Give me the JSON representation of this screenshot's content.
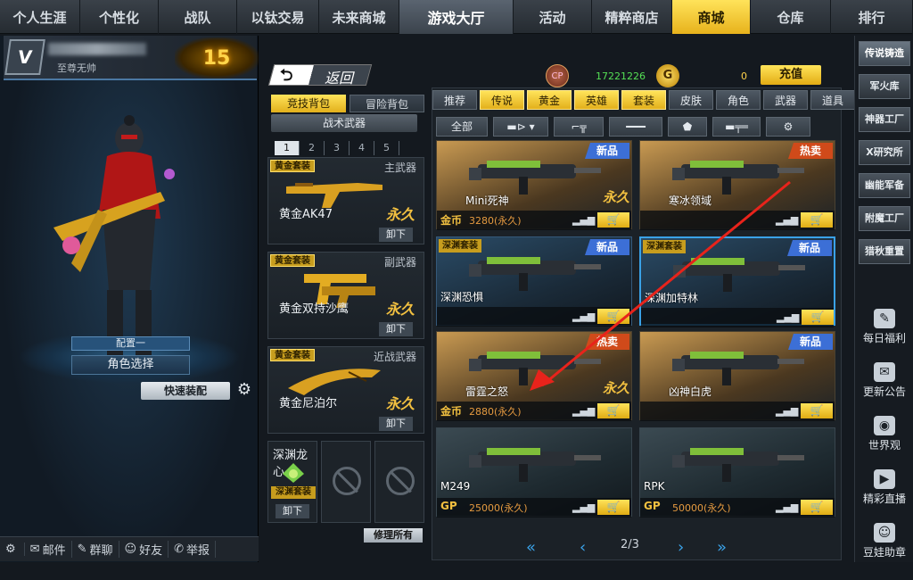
{
  "topnav": {
    "tabs": [
      {
        "label": "个人生涯",
        "w": 90
      },
      {
        "label": "个性化",
        "w": 88
      },
      {
        "label": "战队",
        "w": 88
      },
      {
        "label": "以钛交易",
        "w": 92
      },
      {
        "label": "未来商城",
        "w": 90
      },
      {
        "label": "游戏大厅",
        "w": 128
      },
      {
        "label": "活动",
        "w": 88
      },
      {
        "label": "精粹商店",
        "w": 90
      },
      {
        "label": "商城",
        "w": 88
      },
      {
        "label": "仓库",
        "w": 90
      },
      {
        "label": "排行",
        "w": 92
      }
    ]
  },
  "profile": {
    "badge": "V",
    "rank_level": "15",
    "rank_name": "至尊无帅"
  },
  "character": {
    "config_label": "配置一",
    "role_select": "角色选择",
    "quick_equip": "快速装配"
  },
  "bottombar": {
    "items": [
      {
        "icon": "⚙",
        "label": ""
      },
      {
        "icon": "✉",
        "label": "邮件"
      },
      {
        "icon": "✎",
        "label": "群聊"
      },
      {
        "icon": "☺",
        "label": "好友"
      },
      {
        "icon": "✆",
        "label": "举报"
      }
    ]
  },
  "middle": {
    "back_label": "返回",
    "bag_comp": "竞技背包",
    "bag_adv": "冒险背包",
    "tactical": "战术武器",
    "pages": [
      "1",
      "2",
      "3",
      "4",
      "5"
    ],
    "slots": [
      {
        "tag": "黄金套装",
        "category": "主武器",
        "name": "黄金AK47",
        "perm": "永久",
        "unload": "卸下"
      },
      {
        "tag": "黄金套装",
        "category": "副武器",
        "name": "黄金双持沙鹰",
        "perm": "永久",
        "unload": "卸下"
      },
      {
        "tag": "黄金套装",
        "category": "近战武器",
        "name": "黄金尼泊尔",
        "perm": "永久",
        "unload": "卸下"
      }
    ],
    "dragon": {
      "name": "深渊龙心",
      "tag": "深渊套装",
      "unload": "卸下"
    },
    "repair_all": "修理所有"
  },
  "currency": {
    "cp_icon": "CP",
    "cp_value": "17221226",
    "g_icon": "G",
    "g_value": "0",
    "recharge": "充值"
  },
  "shop": {
    "tabs": [
      {
        "label": "推荐",
        "gold": false
      },
      {
        "label": "传说",
        "gold": true
      },
      {
        "label": "黄金",
        "gold": true
      },
      {
        "label": "英雄",
        "gold": true
      },
      {
        "label": "套装",
        "gold": true
      },
      {
        "label": "皮肤",
        "gold": false
      },
      {
        "label": "角色",
        "gold": false
      },
      {
        "label": "武器",
        "gold": false
      },
      {
        "label": "道具",
        "gold": false
      }
    ],
    "filters": [
      "全部",
      "▬⊳ ▾",
      "⌐╦",
      "━━━",
      "⬟",
      "▬╤═",
      "⚙"
    ],
    "items": [
      {
        "name": "Mini死神",
        "badge": "新品",
        "badge_type": "new",
        "perm": "永久",
        "currency": "金币",
        "price": "3280(永久)",
        "style": "gold",
        "deep": ""
      },
      {
        "name": "寒冰领域",
        "badge": "热卖",
        "badge_type": "hot",
        "perm": "",
        "currency": "",
        "price": "",
        "style": "gold",
        "deep": ""
      },
      {
        "name": "深渊恐惧",
        "badge": "新品",
        "badge_type": "new",
        "perm": "",
        "currency": "",
        "price": "",
        "style": "blue",
        "deep": "深渊套装"
      },
      {
        "name": "深渊加特林",
        "badge": "新品",
        "badge_type": "new",
        "perm": "",
        "currency": "",
        "price": "",
        "style": "blue",
        "deep": "深渊套装"
      },
      {
        "name": "雷霆之怒",
        "badge": "热卖",
        "badge_type": "hot",
        "perm": "永久",
        "currency": "金币",
        "price": "2880(永久)",
        "style": "gold",
        "deep": ""
      },
      {
        "name": "凶神白虎",
        "badge": "新品",
        "badge_type": "new",
        "perm": "",
        "currency": "",
        "price": "",
        "style": "gold",
        "deep": ""
      },
      {
        "name": "M249",
        "badge": "",
        "badge_type": "",
        "perm": "",
        "currency": "GP",
        "price": "25000(永久)",
        "style": "dark",
        "deep": ""
      },
      {
        "name": "RPK",
        "badge": "",
        "badge_type": "",
        "perm": "",
        "currency": "GP",
        "price": "50000(永久)",
        "style": "dark",
        "deep": ""
      }
    ],
    "signal_icon": "▂▄▆",
    "cart_icon": "🛒",
    "pager": {
      "first": "«",
      "prev": "‹",
      "page": "2/3",
      "next": "›",
      "last": "»"
    }
  },
  "right": {
    "menu": [
      "传说铸造",
      "军火库",
      "神器工厂",
      "X研究所",
      "幽能军备",
      "附魔工厂",
      "猎秋重置"
    ],
    "side": [
      {
        "icon": "✎",
        "label": "每日福利"
      },
      {
        "icon": "✉",
        "label": "更新公告"
      },
      {
        "icon": "◉",
        "label": "世界观"
      },
      {
        "icon": "▶",
        "label": "精彩直播"
      },
      {
        "icon": "☺",
        "label": "豆娃助章"
      }
    ]
  }
}
